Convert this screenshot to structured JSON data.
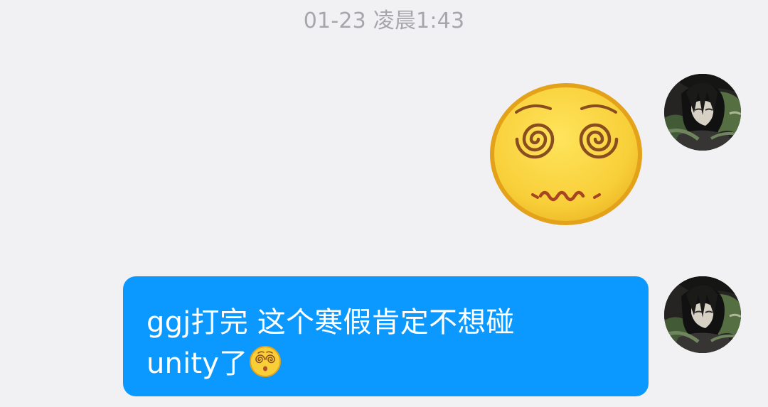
{
  "chat": {
    "timestamp": "01-23 凌晨1:43",
    "messages": [
      {
        "type": "sticker",
        "sticker_icon": "dizzy-face-emoji-icon"
      },
      {
        "type": "text",
        "line1": "ggj打完 这个寒假肯定不想碰",
        "line2": "unity了",
        "inline_emoji_icon": "dizzy-face-emoji-icon",
        "bubble_color": "#0b99ff",
        "text_color": "#ffffff"
      }
    ]
  },
  "colors": {
    "background": "#f1f1f3",
    "timestamp_text": "#a6a6ab",
    "emoji_face": "#f8cf39",
    "emoji_outline": "#e3a21a",
    "emoji_features": "#8a4d1f"
  }
}
